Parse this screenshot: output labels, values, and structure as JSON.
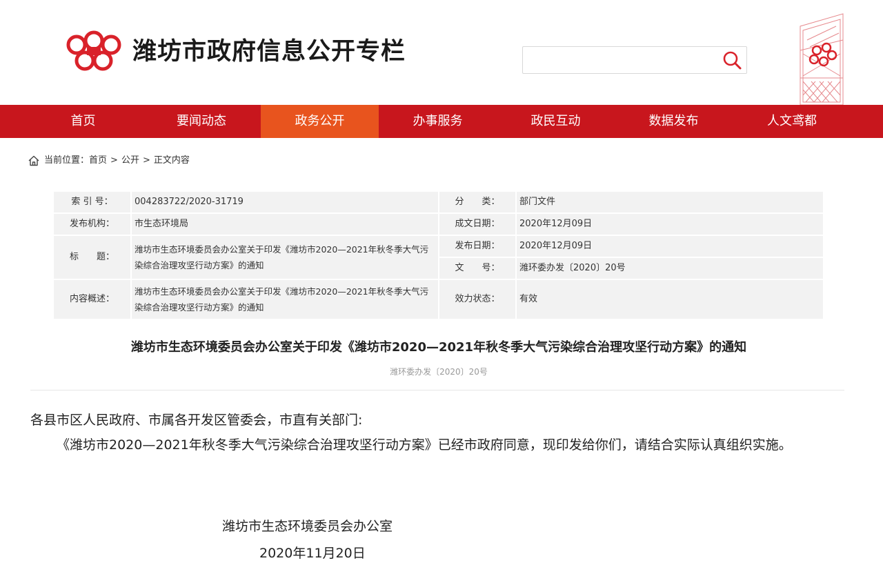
{
  "header": {
    "site_title": "潍坊市政府信息公开专栏",
    "search": {
      "placeholder": "",
      "value": ""
    },
    "icons": {
      "logo": "weifang-kite-logo",
      "search": "search-icon",
      "decoration": "kite-decoration"
    }
  },
  "nav": {
    "active_index": 2,
    "items": [
      {
        "label": "首页"
      },
      {
        "label": "要闻动态"
      },
      {
        "label": "政务公开"
      },
      {
        "label": "办事服务"
      },
      {
        "label": "政民互动"
      },
      {
        "label": "数据发布"
      },
      {
        "label": "人文鸢都"
      }
    ]
  },
  "breadcrumb": {
    "prefix": "当前位置：",
    "items": [
      "首页",
      "公开",
      "正文内容"
    ],
    "separator": ">"
  },
  "meta": {
    "index_no": {
      "label": "索 引 号：",
      "value": "004283722/2020-31719"
    },
    "category": {
      "label": "分　　类：",
      "value": "部门文件"
    },
    "publisher": {
      "label": "发布机构：",
      "value": "市生态环境局"
    },
    "written_date": {
      "label": "成文日期：",
      "value": "2020年12月09日"
    },
    "title": {
      "label": "标　　题：",
      "value": "潍坊市生态环境委员会办公室关于印发《潍坊市2020—2021年秋冬季大气污染综合治理攻坚行动方案》的通知"
    },
    "publish_date": {
      "label": "发布日期：",
      "value": "2020年12月09日"
    },
    "doc_no": {
      "label": "文　　号：",
      "value": "潍环委办发〔2020〕20号"
    },
    "summary": {
      "label": "内容概述：",
      "value": "潍坊市生态环境委员会办公室关于印发《潍坊市2020—2021年秋冬季大气污染综合治理攻坚行动方案》的通知"
    },
    "validity": {
      "label": "效力状态：",
      "value": "有效"
    }
  },
  "article": {
    "title": "潍坊市生态环境委员会办公室关于印发《潍坊市2020—2021年秋冬季大气污染综合治理攻坚行动方案》的通知",
    "doc_no": "潍环委办发〔2020〕20号",
    "salutation": "各县市区人民政府、市属各开发区管委会，市直有关部门:",
    "body": "《潍坊市2020—2021年秋冬季大气污染综合治理攻坚行动方案》已经市政府同意，现印发给你们，请结合实际认真组织实施。",
    "signature_org": "潍坊市生态环境委员会办公室",
    "signature_date": "2020年11月20日"
  },
  "colors": {
    "nav_bg": "#c8161d",
    "nav_active": "#e8541e",
    "logo_red": "#d9222a",
    "cell_bg": "#f2f2f2"
  }
}
